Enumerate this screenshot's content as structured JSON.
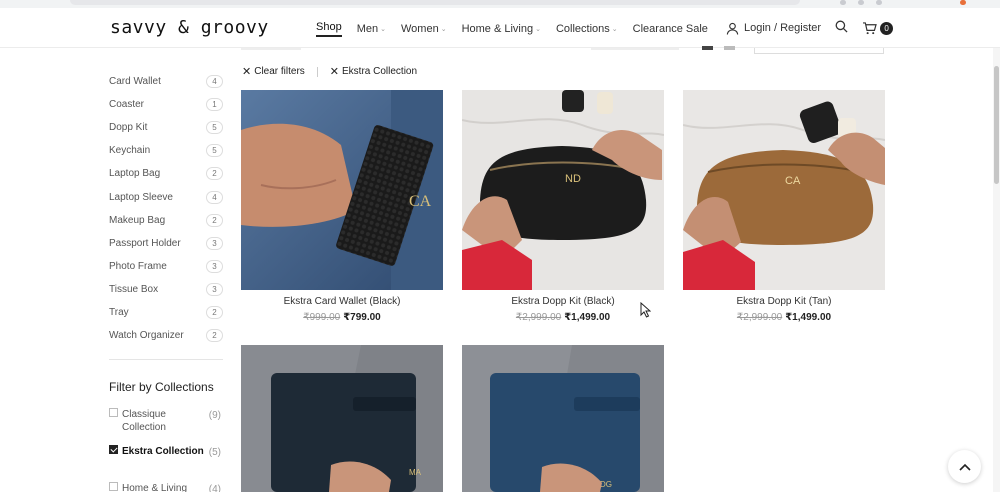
{
  "header": {
    "logo": "savvy & groovy",
    "nav": [
      {
        "label": "Shop",
        "caret": false,
        "active": true
      },
      {
        "label": "Men",
        "caret": true,
        "active": false
      },
      {
        "label": "Women",
        "caret": true,
        "active": false
      },
      {
        "label": "Home & Living",
        "caret": true,
        "active": false
      },
      {
        "label": "Collections",
        "caret": true,
        "active": false
      },
      {
        "label": "Clearance Sale",
        "caret": false,
        "active": false
      }
    ],
    "login_label": "Login / Register",
    "cart_count": "0"
  },
  "sidebar": {
    "categories": [
      {
        "label": "Card Wallet",
        "count": "4"
      },
      {
        "label": "Coaster",
        "count": "1"
      },
      {
        "label": "Dopp Kit",
        "count": "5"
      },
      {
        "label": "Keychain",
        "count": "5"
      },
      {
        "label": "Laptop Bag",
        "count": "2"
      },
      {
        "label": "Laptop Sleeve",
        "count": "4"
      },
      {
        "label": "Makeup Bag",
        "count": "2"
      },
      {
        "label": "Passport Holder",
        "count": "3"
      },
      {
        "label": "Photo Frame",
        "count": "3"
      },
      {
        "label": "Tissue Box",
        "count": "3"
      },
      {
        "label": "Tray",
        "count": "2"
      },
      {
        "label": "Watch Organizer",
        "count": "2"
      }
    ],
    "filter_title": "Filter by Collections",
    "collections": [
      {
        "label": "Classique Collection",
        "count": "(9)",
        "checked": false
      },
      {
        "label": "Ekstra Collection",
        "count": "(5)",
        "checked": true
      },
      {
        "label": "Home & Living",
        "count": "(4)",
        "checked": false
      }
    ]
  },
  "filters": {
    "clear_label": "Clear filters",
    "active_label": "Ekstra Collection"
  },
  "products": [
    {
      "name": "Ekstra Card Wallet (Black)",
      "old_price": "₹999.00",
      "new_price": "₹799.00",
      "monogram": "CA"
    },
    {
      "name": "Ekstra Dopp Kit (Black)",
      "old_price": "₹2,999.00",
      "new_price": "₹1,499.00",
      "monogram": "ND"
    },
    {
      "name": "Ekstra Dopp Kit (Tan)",
      "old_price": "₹2,999.00",
      "new_price": "₹1,499.00",
      "monogram": "CA"
    },
    {
      "name": "",
      "old_price": "",
      "new_price": "",
      "monogram": "MA"
    },
    {
      "name": "",
      "old_price": "",
      "new_price": "",
      "monogram": "DG"
    }
  ],
  "colors": {
    "accent": "#222222",
    "sleeve_red": "#d8283a",
    "denim": "#3f5f86",
    "tan": "#a3723f"
  }
}
